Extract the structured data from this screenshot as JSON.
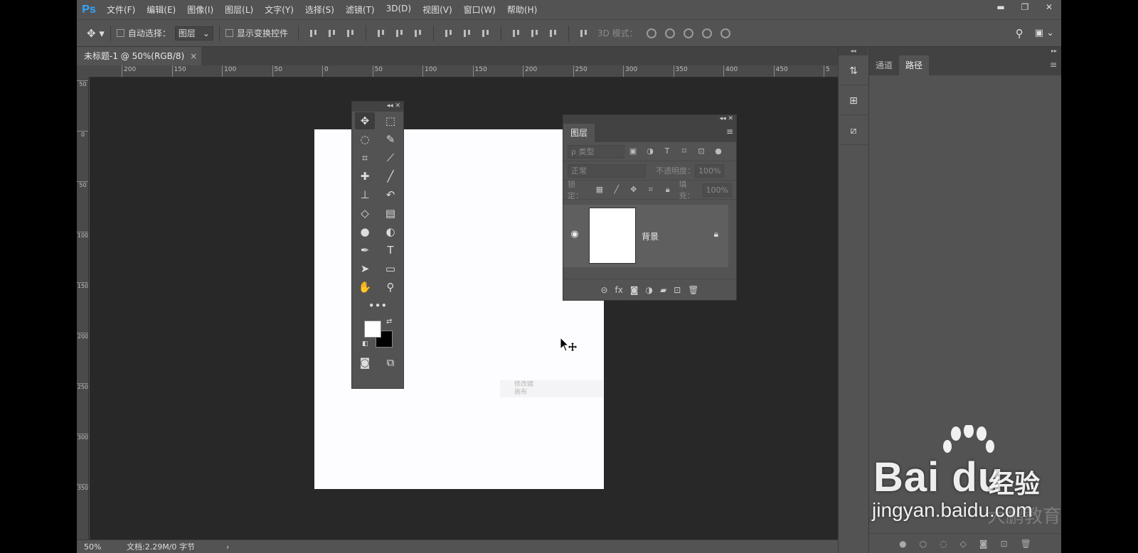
{
  "app": {
    "logo": "Ps",
    "accent": "#31a8ff"
  },
  "menu": [
    "文件(F)",
    "编辑(E)",
    "图像(I)",
    "图层(L)",
    "文字(Y)",
    "选择(S)",
    "滤镜(T)",
    "3D(D)",
    "视图(V)",
    "窗口(W)",
    "帮助(H)"
  ],
  "window_controls": {
    "minimize": "▬",
    "restore": "❐",
    "close": "✕"
  },
  "options_bar": {
    "auto_select_label": "自动选择：",
    "auto_select_target": "图层",
    "show_transform_label": "显示变换控件",
    "mode_3d_label": "3D 模式："
  },
  "document_tab": {
    "title": "未标题-1 @ 50%(RGB/8)",
    "close": "×"
  },
  "ruler": {
    "h_labels": [
      "200",
      "150",
      "100",
      "50",
      "0",
      "50",
      "100",
      "150",
      "200",
      "250",
      "300",
      "350",
      "400",
      "450",
      "5"
    ],
    "v_labels": [
      "50",
      "0",
      "50",
      "100",
      "150",
      "200",
      "250",
      "300",
      "350"
    ]
  },
  "canvas": {
    "background": "#282828",
    "document_color": "#fdfcfe",
    "ghost_text": [
      "修改键",
      "画布"
    ]
  },
  "tools_panel": {
    "header": "◂◂ ✕",
    "tools": [
      [
        "move-tool",
        "✥"
      ],
      [
        "marquee-tool",
        "⬚"
      ],
      [
        "lasso-tool",
        "◌"
      ],
      [
        "quick-select-tool",
        "✎"
      ],
      [
        "crop-tool",
        "⌗"
      ],
      [
        "eyedropper-tool",
        "⟋"
      ],
      [
        "healing-tool",
        "✚"
      ],
      [
        "brush-tool",
        "╱"
      ],
      [
        "stamp-tool",
        "⊥"
      ],
      [
        "history-brush-tool",
        "↶"
      ],
      [
        "eraser-tool",
        "◇"
      ],
      [
        "gradient-tool",
        "▤"
      ],
      [
        "blur-tool",
        "●"
      ],
      [
        "dodge-tool",
        "◐"
      ],
      [
        "pen-tool",
        "✒"
      ],
      [
        "type-tool",
        "T"
      ],
      [
        "path-select-tool",
        "➤"
      ],
      [
        "shape-tool",
        "▭"
      ],
      [
        "hand-tool",
        "✋"
      ],
      [
        "zoom-tool",
        "⚲"
      ],
      [
        "more-tools",
        "•••"
      ]
    ],
    "bottom": [
      "quick-mask",
      "◙",
      "screen-mode",
      "⧉"
    ]
  },
  "layers_panel": {
    "header": "◂◂ ✕",
    "tab": "图层",
    "filter_label": "ρ 类型",
    "blend_mode": "正常",
    "opacity_label": "不透明度：",
    "opacity_value": "100%",
    "lock_label": "锁定：",
    "fill_label": "填充：",
    "fill_value": "100%",
    "layer_name": "背景",
    "footer_icons": [
      "⊝",
      "fx",
      "◙",
      "◑",
      "▰",
      "⊡",
      "🗑"
    ]
  },
  "right_strip": {
    "header": "◂◂",
    "buttons": [
      "⇅",
      "⊞",
      "⧄"
    ]
  },
  "right_panel": {
    "header": "▸▸",
    "tabs": [
      "通道",
      "路径"
    ],
    "active_tab": 1,
    "footer_icons": [
      "●",
      "○",
      "◌",
      "◇",
      "◙",
      "⊡",
      "🗑"
    ]
  },
  "status": {
    "zoom": "50%",
    "doc_size": "文档:2.29M/0 字节",
    "arrow": "›"
  },
  "watermark": {
    "brand": "Bai  du",
    "product": "经验",
    "url": "jingyan.baidu.com",
    "overlay": "大鹏教育"
  }
}
